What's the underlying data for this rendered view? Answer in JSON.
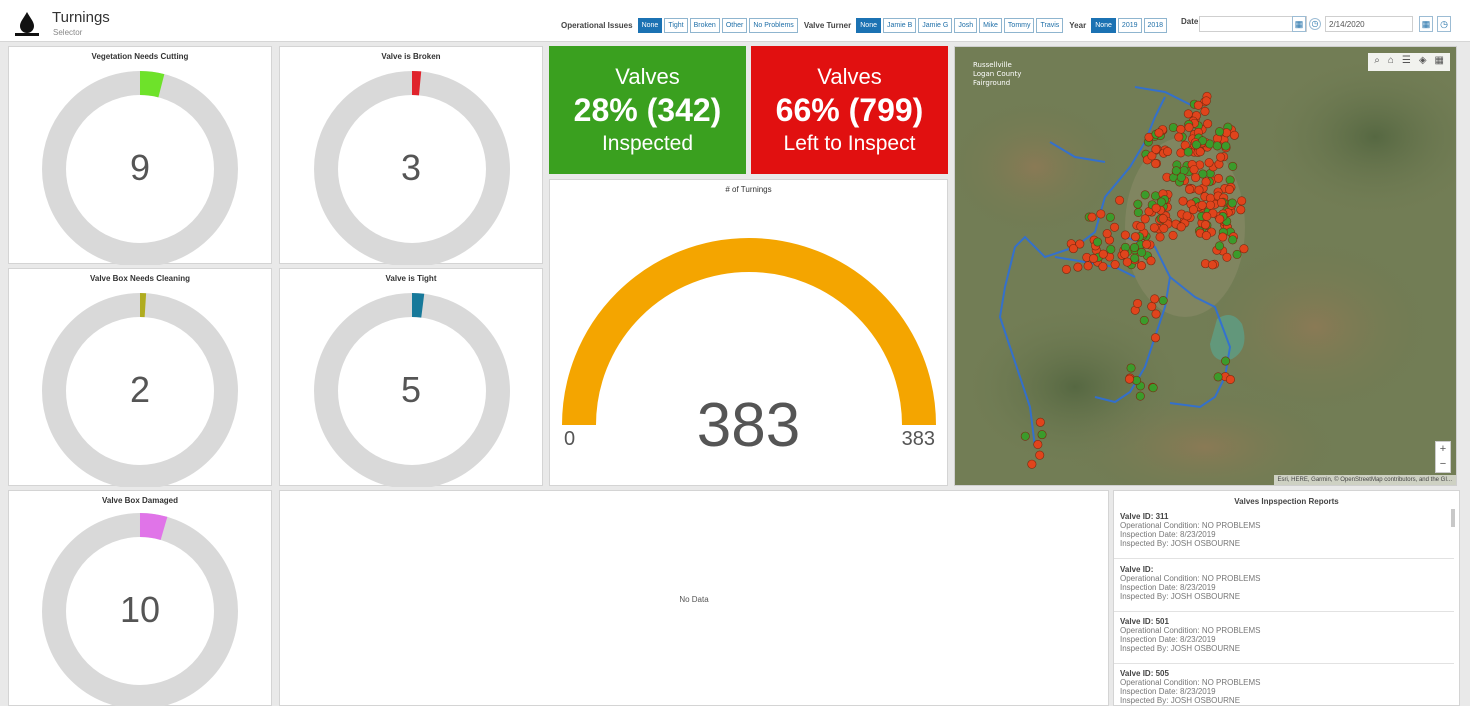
{
  "header": {
    "title": "Turnings",
    "subtitle": "Selector"
  },
  "selectors": {
    "operational": {
      "label": "Operational Issues",
      "options": [
        "None",
        "Tight",
        "Broken",
        "Other",
        "No Problems"
      ],
      "selected": "None"
    },
    "turner": {
      "label": "Valve Turner",
      "options": [
        "None",
        "Jamie B",
        "Jamie G",
        "Josh",
        "Mike",
        "Tommy",
        "Travis"
      ],
      "selected": "None"
    },
    "year": {
      "label": "Year",
      "options": [
        "None",
        "2019",
        "2018"
      ],
      "selected": "None"
    },
    "date_range": {
      "label": "Date Range",
      "end_value": "2/14/2020"
    }
  },
  "donuts": [
    {
      "title": "Vegetation Needs Cutting",
      "value": "9",
      "fraction": 0.04,
      "color": "#6ee22a"
    },
    {
      "title": "Valve is Broken",
      "value": "3",
      "fraction": 0.015,
      "color": "#e0232c"
    },
    {
      "title": "Valve Box Needs Cleaning",
      "value": "2",
      "fraction": 0.01,
      "color": "#b0ac1f"
    },
    {
      "title": "Valve is Tight",
      "value": "5",
      "fraction": 0.02,
      "color": "#17799a"
    },
    {
      "title": "Valve Box Damaged",
      "value": "10",
      "fraction": 0.045,
      "color": "#e074e8"
    }
  ],
  "kpis": {
    "inspected": {
      "line1": "Valves",
      "line2": "28% (342)",
      "line3": "Inspected",
      "color": "#3aa01f"
    },
    "left": {
      "line1": "Valves",
      "line2": "66% (799)",
      "line3": "Left to Inspect",
      "color": "#e11010"
    }
  },
  "gauge": {
    "title": "# of Turnings",
    "min": "0",
    "max": "383",
    "value": "383",
    "fraction": 1.0,
    "color": "#f4a500"
  },
  "map": {
    "labels": [
      "Russellville",
      "Logan County",
      "Fairground"
    ],
    "attribution": "Esri, HERE, Garmin, © OpenStreetMap contributors, and the GI...",
    "legend_colors": {
      "inspected": "#3b9b2b",
      "not_inspected": "#e0441c"
    }
  },
  "middle_panel": {
    "text": "No Data"
  },
  "reports": {
    "title": "Valves Inpspection Reports",
    "items": [
      {
        "id": "Valve ID: 311",
        "condition": "Operational Condition: NO PROBLEMS",
        "date": "Inspection Date: 8/23/2019",
        "by": "Inspected By:  JOSH OSBOURNE"
      },
      {
        "id": "Valve ID:",
        "condition": "Operational Condition: NO PROBLEMS",
        "date": "Inspection Date: 8/23/2019",
        "by": "Inspected By:  JOSH OSBOURNE"
      },
      {
        "id": "Valve ID: 501",
        "condition": "Operational Condition: NO PROBLEMS",
        "date": "Inspection Date: 8/23/2019",
        "by": "Inspected By:  JOSH OSBOURNE"
      },
      {
        "id": "Valve ID: 505",
        "condition": "Operational Condition: NO PROBLEMS",
        "date": "Inspection Date: 8/23/2019",
        "by": "Inspected By:  JOSH OSBOURNE"
      }
    ]
  }
}
